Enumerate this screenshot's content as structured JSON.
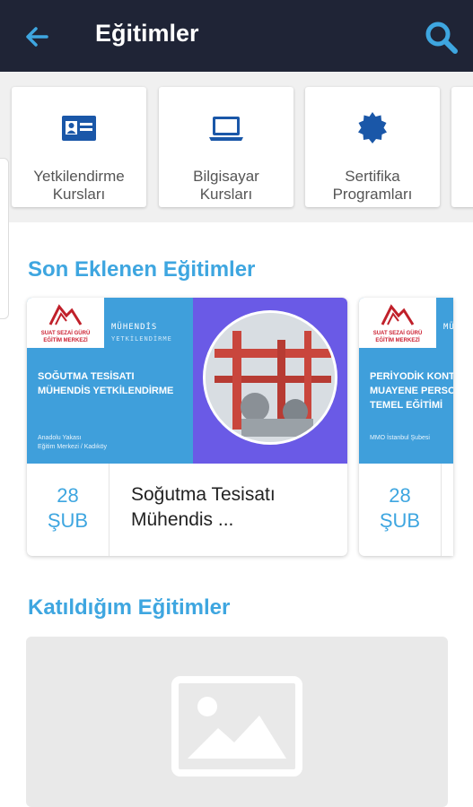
{
  "appbar": {
    "title": "Eğitimler",
    "back_icon": "arrow-left-icon",
    "search_icon": "search-icon",
    "bg": "#1f2436",
    "accent": "#3ea6e0"
  },
  "categories": [
    {
      "label_line1": "Yetkilendirme",
      "label_line2": "Kursları",
      "icon": "id-card-icon"
    },
    {
      "label_line1": "Bilgisayar",
      "label_line2": "Kursları",
      "icon": "laptop-icon"
    },
    {
      "label_line1": "Sertifika",
      "label_line2": "Programları",
      "icon": "badge-icon"
    }
  ],
  "recent": {
    "title": "Son Eklenen Eğitimler",
    "cards": [
      {
        "banner_logo_line1": "SUAT SEZAİ GÜRÜ",
        "banner_logo_line2": "EĞİTİM MERKEZİ",
        "banner_tag1": "MÜHENDİS",
        "banner_tag2": "YETKİLENDİRME",
        "banner_caption1": "SOĞUTMA TESİSATI",
        "banner_caption2": "MÜHENDİS YETKİLENDİRME",
        "banner_loc1": "Anadolu Yakası",
        "banner_loc2": "Eğitim Merkezi / Kadıköy",
        "day": "28",
        "month": "ŞUB",
        "title_line1": "Soğutma Tesisatı",
        "title_line2": "Mühendis ..."
      },
      {
        "banner_logo_line1": "SUAT SEZAİ GÜRÜ",
        "banner_logo_line2": "EĞİTİM MERKEZİ",
        "banner_tag1": "MÜ",
        "banner_caption1": "PERİYODİK KONTROL",
        "banner_caption2": "MUAYENE PERSONE",
        "banner_caption3": "TEMEL EĞİTİMİ",
        "banner_loc1": "MMO İstanbul Şubesi",
        "day": "28",
        "month": "ŞUB"
      }
    ]
  },
  "joined": {
    "title": "Katıldığım Eğitimler",
    "placeholder_icon": "image-placeholder-icon"
  }
}
